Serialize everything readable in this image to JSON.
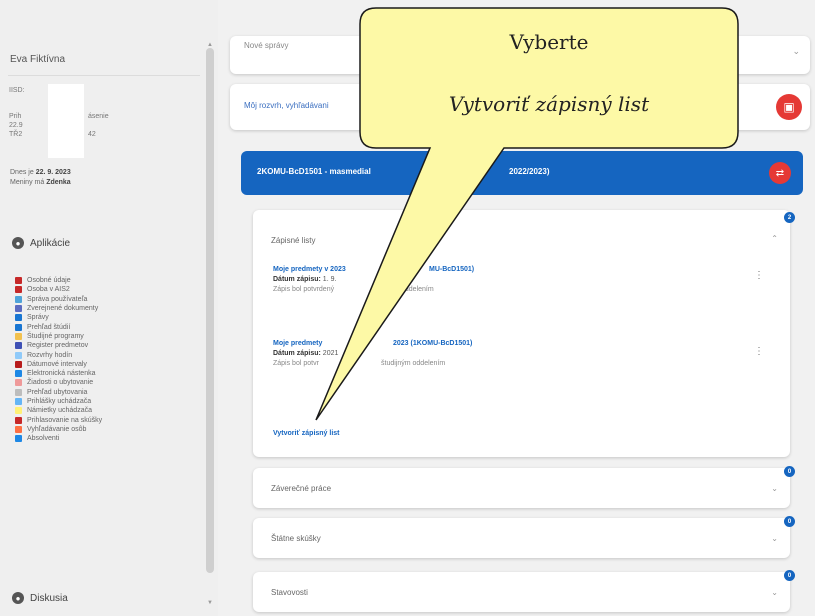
{
  "sidebar": {
    "user_name": "Eva Fiktívna",
    "info_lines": [
      "IISD:",
      "",
      "Prih",
      "22.9",
      "TŘ2"
    ],
    "info_right": [
      "",
      "",
      "ásenie",
      "",
      "42"
    ],
    "today_label": "Dnes je",
    "today_value": "22. 9. 2023",
    "week_label": "Meniny má",
    "week_value": "Zdenka",
    "apps_header": "Aplikácie",
    "apps": [
      {
        "label": "Osobné údaje",
        "color": "#c62828"
      },
      {
        "label": "Osoba v AIS2",
        "color": "#c62828"
      },
      {
        "label": "Správa používateľa",
        "color": "#4fa3d9"
      },
      {
        "label": "Zverejnené dokumenty",
        "color": "#5c6bc0"
      },
      {
        "label": "Správy",
        "color": "#1976d2"
      },
      {
        "label": "Prehľad štúdií",
        "color": "#1976d2"
      },
      {
        "label": "Študijné programy",
        "color": "#f2c14e"
      },
      {
        "label": "Register predmetov",
        "color": "#3f51b5"
      },
      {
        "label": "Rozvrhy hodín",
        "color": "#90caf9"
      },
      {
        "label": "Dátumové intervaly",
        "color": "#b71c1c"
      },
      {
        "label": "Elektronická nástenka",
        "color": "#1e88e5"
      },
      {
        "label": "Žiadosti o ubytovanie",
        "color": "#ef9a9a"
      },
      {
        "label": "Prehľad ubytovania",
        "color": "#bdbdbd"
      },
      {
        "label": "Prihlášky uchádzača",
        "color": "#64b5f6"
      },
      {
        "label": "Námietky uchádzača",
        "color": "#fff176"
      },
      {
        "label": "Prihlasovanie na skúšky",
        "color": "#c62828"
      },
      {
        "label": "Vyhľadávanie osôb",
        "color": "#ff7043"
      },
      {
        "label": "Absolventi",
        "color": "#1e88e5"
      }
    ],
    "discussion_header": "Diskusia"
  },
  "main": {
    "messages_label": "Nové správy",
    "search_label": "Môj rozvrh, vyhľadávani",
    "study_label": "2KOMU-BcD1501 - masmedial",
    "study_suffix": "2022/2023)",
    "enrollment_title": "Zápisné listy",
    "enrollment_badge": "2",
    "entries": [
      {
        "title": "Moje predmety v 2023",
        "title_right": "MU-BcD1501)",
        "date_label": "Dátum zápisu:",
        "date_value": "1. 9.",
        "note": "Zápis bol potvrdený",
        "note_right": "oddelením"
      },
      {
        "title": "Moje predmety",
        "title_right": "2023 (1KOMU-BcD1501)",
        "date_label": "Dátum zápisu:",
        "date_value": "2021",
        "note": "Zápis bol potvr",
        "note_right": "študijným oddelením"
      }
    ],
    "create_link": "Vytvoriť zápisný list",
    "final_theses": {
      "title": "Záverečné práce",
      "badge": "0"
    },
    "state_exams": {
      "title": "Štátne skúšky",
      "badge": "0"
    },
    "statuses": {
      "title": "Stavovosti",
      "badge": "0"
    }
  },
  "callout": {
    "title": "Vyberte",
    "action": "Vytvoriť zápisný list"
  },
  "colors": {
    "accent_blue": "#1565c0",
    "alert_red": "#e53935",
    "callout_fill": "#fdf9a6"
  }
}
